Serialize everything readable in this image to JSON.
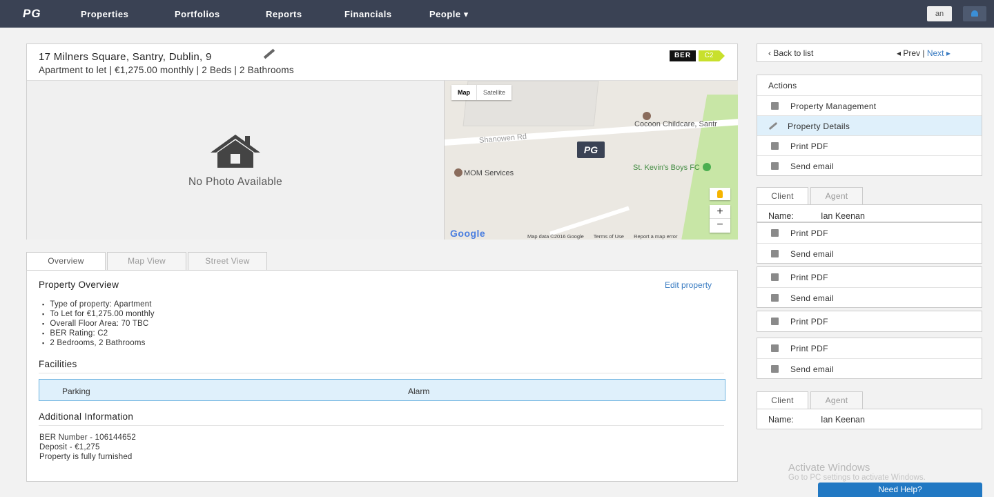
{
  "nav": {
    "logo": "PG",
    "items": [
      "Properties",
      "Portfolios",
      "Reports",
      "Financials",
      "People ▾"
    ],
    "user_initials": "an"
  },
  "property": {
    "address": "17 Milners Square, Santry, Dublin, 9",
    "summary": "Apartment to let  |  €1,275.00 monthly  |  2 Beds  |  2 Bathrooms",
    "ber_label": "BER",
    "ber_rating": "C2",
    "no_photo": "No Photo Available"
  },
  "map": {
    "type_buttons": [
      "Map",
      "Satellite"
    ],
    "labels": {
      "road": "Shanowen Rd",
      "poi1": "Cocoon Childcare, Santr",
      "poi2": "MOM Services",
      "poi3": "St. Kevin's Boys FC"
    },
    "marker": "PG",
    "brand": "Google",
    "footer": [
      "Map data ©2016 Google",
      "Terms of Use",
      "Report a map error"
    ],
    "zoom_in": "+",
    "zoom_out": "−"
  },
  "tabs": [
    "Overview",
    "Map View",
    "Street View"
  ],
  "overview": {
    "title": "Property Overview",
    "edit_link": "Edit property",
    "bullets": [
      "Type of property: Apartment",
      "To Let for €1,275.00 monthly",
      "Overall Floor Area: 70 TBC",
      "BER Rating: C2",
      "2 Bedrooms, 2 Bathrooms"
    ],
    "facilities_title": "Facilities",
    "facilities": [
      "Parking",
      "Alarm"
    ],
    "additional_title": "Additional Information",
    "additional": [
      "BER Number - 106144652",
      "Deposit - €1,275",
      "Property is fully furnished"
    ]
  },
  "sidebar": {
    "back": "‹  Back to list",
    "prev": "◂  Prev",
    "sep": " | ",
    "next": "Next  ▸",
    "actions_title": "Actions",
    "actions": [
      "Property Management",
      "Property Details",
      "Print PDF",
      "Send email"
    ],
    "client_tabs": [
      "Client",
      "Agent"
    ],
    "name_key": "Name:",
    "name_value": "Ian Keenan",
    "print": "Print PDF",
    "email": "Send email"
  },
  "watermark": {
    "line1": "Activate Windows",
    "line2": "Go to PC settings to activate Windows."
  },
  "help": "Need Help?"
}
